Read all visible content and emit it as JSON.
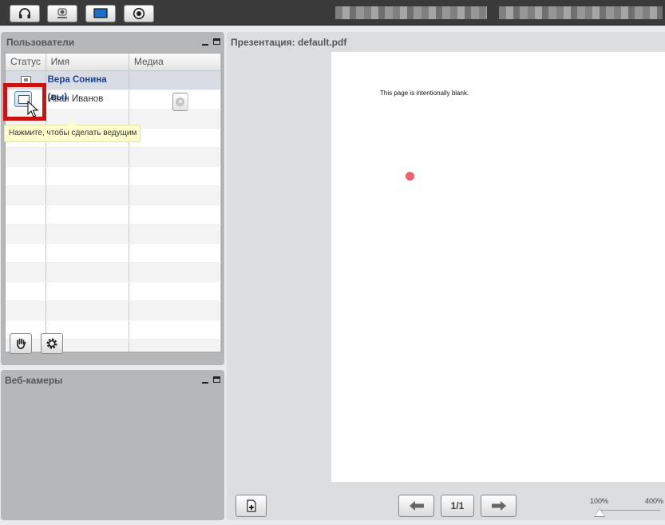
{
  "toolbar": {
    "buttons": [
      {
        "icon": "headset-icon"
      },
      {
        "icon": "webcam-icon"
      },
      {
        "icon": "desktop-share-icon"
      },
      {
        "icon": "record-icon"
      }
    ]
  },
  "users_panel": {
    "title": "Пользователи",
    "columns": [
      "Статус",
      "Имя",
      "Медиа"
    ],
    "rows": [
      {
        "name": "Вера Сонина (вы)",
        "is_self": true,
        "status_icon": "presenter-icon"
      },
      {
        "name": "Иван Иванов",
        "is_self": false,
        "status_icon": "make-presenter-icon",
        "media_icon": "mute-icon"
      }
    ],
    "tooltip": "Нажмите, чтобы сделать ведущим",
    "buttons": [
      {
        "icon": "raise-hand-icon"
      },
      {
        "icon": "settings-gear-icon"
      }
    ]
  },
  "webcams_panel": {
    "title": "Веб-камеры"
  },
  "presentation": {
    "title": "Презентация: default.pdf",
    "page_text": "This page is intentionally blank.",
    "page_indicator": "1/1",
    "zoom_min": "100%",
    "zoom_max": "400%",
    "zoom_level": 0,
    "laser_color": "#ef6068"
  },
  "colors": {
    "highlight": "#cc1111",
    "tooltip_bg": "#ffffcc",
    "self_name": "#1a3f9a"
  }
}
